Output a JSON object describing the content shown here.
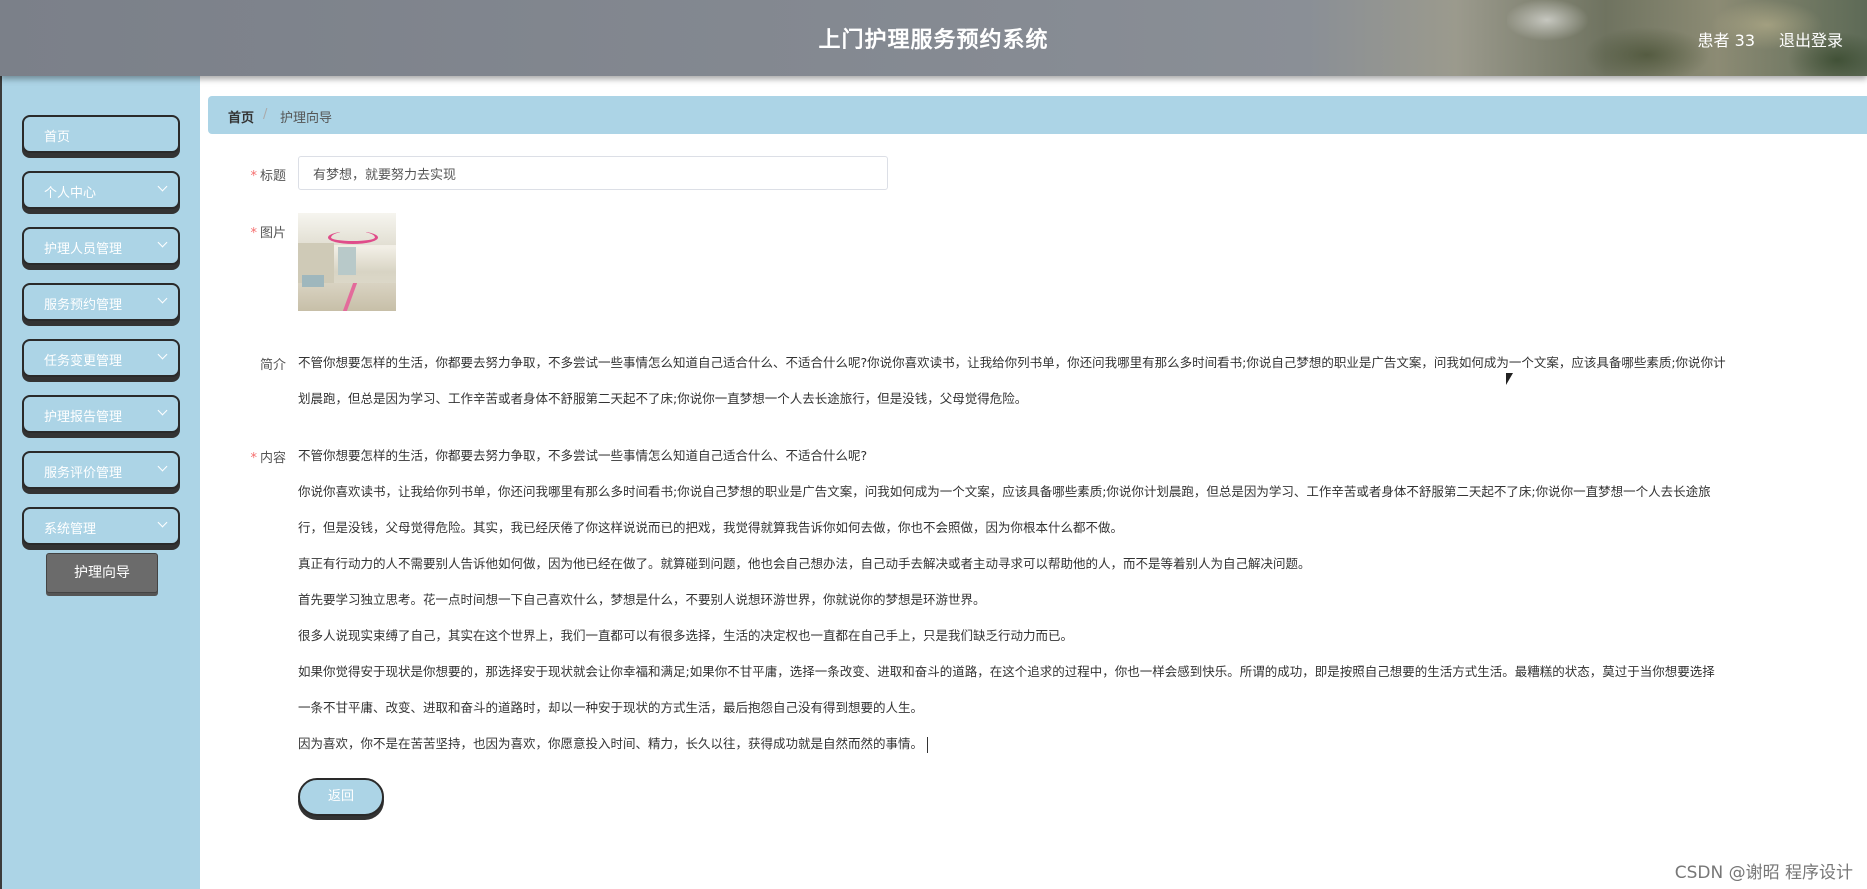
{
  "header": {
    "title": "上门护理服务预约系统",
    "user_label": "患者 33",
    "logout_label": "退出登录"
  },
  "sidebar": {
    "items": [
      {
        "label": "首页",
        "has_submenu": false
      },
      {
        "label": "个人中心",
        "has_submenu": true
      },
      {
        "label": "护理人员管理",
        "has_submenu": true
      },
      {
        "label": "服务预约管理",
        "has_submenu": true
      },
      {
        "label": "任务变更管理",
        "has_submenu": true
      },
      {
        "label": "护理报告管理",
        "has_submenu": true
      },
      {
        "label": "服务评价管理",
        "has_submenu": true
      },
      {
        "label": "系统管理",
        "has_submenu": true
      }
    ],
    "active_subitem": "护理向导"
  },
  "breadcrumb": {
    "home": "首页",
    "separator": "/",
    "current": "护理向导"
  },
  "form": {
    "title_label": "标题",
    "title_value": "有梦想，就要努力去实现",
    "image_label": "图片",
    "intro_label": "简介",
    "intro_lines": [
      "不管你想要怎样的生活，你都要去努力争取，不多尝试一些事情怎么知道自己适合什么、不适合什么呢?你说你喜欢读书，让我给你列书单，你还问我哪里有那么多时间看书;你说自己梦想的职业是广告文案，问我如何成为一个文案，应该具备哪些素质;你说你计",
      "划晨跑，但总是因为学习、工作辛苦或者身体不舒服第二天起不了床;你说你一直梦想一个人去长途旅行，但是没钱，父母觉得危险。"
    ],
    "content_label": "内容",
    "content_lines": [
      "不管你想要怎样的生活，你都要去努力争取，不多尝试一些事情怎么知道自己适合什么、不适合什么呢?",
      "你说你喜欢读书，让我给你列书单，你还问我哪里有那么多时间看书;你说自己梦想的职业是广告文案，问我如何成为一个文案，应该具备哪些素质;你说你计划晨跑，但总是因为学习、工作辛苦或者身体不舒服第二天起不了床;你说你一直梦想一个人去长途旅",
      "行，但是没钱，父母觉得危险。其实，我已经厌倦了你这样说说而已的把戏，我觉得就算我告诉你如何去做，你也不会照做，因为你根本什么都不做。",
      "真正有行动力的人不需要别人告诉他如何做，因为他已经在做了。就算碰到问题，他也会自己想办法，自己动手去解决或者主动寻求可以帮助他的人，而不是等着别人为自己解决问题。",
      "首先要学习独立思考。花一点时间想一下自己喜欢什么，梦想是什么，不要别人说想环游世界，你就说你的梦想是环游世界。",
      "很多人说现实束缚了自己，其实在这个世界上，我们一直都可以有很多选择，生活的决定权也一直都在自己手上，只是我们缺乏行动力而已。",
      "如果你觉得安于现状是你想要的，那选择安于现状就会让你幸福和满足;如果你不甘平庸，选择一条改变、进取和奋斗的道路，在这个追求的过程中，你也一样会感到快乐。所谓的成功，即是按照自己想要的生活方式生活。最糟糕的状态，莫过于当你想要选择",
      "一条不甘平庸、改变、进取和奋斗的道路时，却以一种安于现状的方式生活，最后抱怨自己没有得到想要的人生。",
      "因为喜欢，你不是在苦苦坚持，也因为喜欢，你愿意投入时间、精力，长久以往，获得成功就是自然而然的事情。"
    ],
    "back_label": "返回"
  },
  "watermark": "CSDN @谢昭  程序设计",
  "colors": {
    "accent": "#acd4e6",
    "required": "#f56c6c",
    "active_subitem": "#6b6b6b"
  }
}
